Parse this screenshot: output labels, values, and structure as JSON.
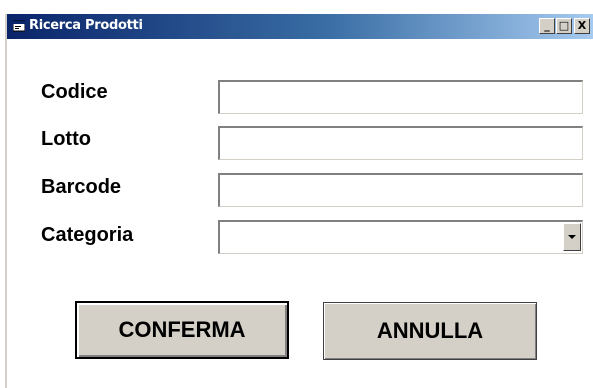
{
  "window": {
    "title": "Ricerca Prodotti",
    "title_icon": "app-form-icon",
    "controls": {
      "minimize": "_",
      "maximize": "□",
      "close": "X"
    }
  },
  "form": {
    "fields": [
      {
        "label": "Codice",
        "value": ""
      },
      {
        "label": "Lotto",
        "value": ""
      },
      {
        "label": "Barcode",
        "value": ""
      },
      {
        "label": "Categoria",
        "value": "",
        "type": "combobox"
      }
    ]
  },
  "buttons": {
    "confirm_label": "CONFERMA",
    "cancel_label": "ANNULLA"
  },
  "colors": {
    "titlebar_start": "#0a246a",
    "titlebar_end": "#a6caf0",
    "face": "#d4d0c8"
  }
}
